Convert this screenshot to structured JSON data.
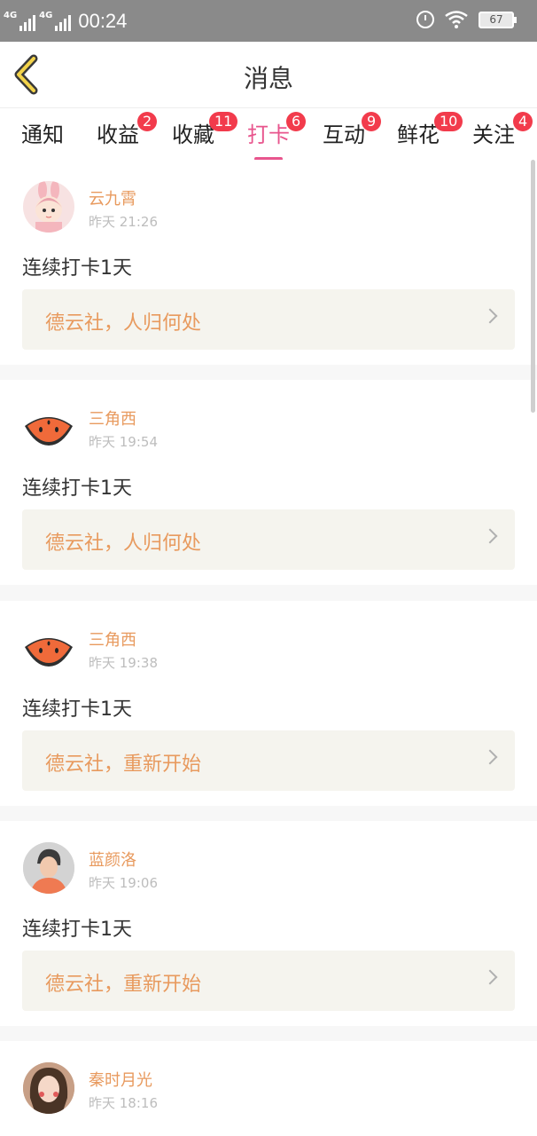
{
  "status_bar": {
    "signal1": "4G",
    "signal2": "4G",
    "time": "00:24",
    "battery": "67"
  },
  "header": {
    "title": "消息"
  },
  "tabs": [
    {
      "label": "通知",
      "badge": ""
    },
    {
      "label": "收益",
      "badge": "2"
    },
    {
      "label": "收藏",
      "badge": "11"
    },
    {
      "label": "打卡",
      "badge": "6"
    },
    {
      "label": "互动",
      "badge": "9"
    },
    {
      "label": "鲜花",
      "badge": "10"
    },
    {
      "label": "关注",
      "badge": "4"
    }
  ],
  "messages": [
    {
      "user": "云九霄",
      "time": "昨天 21:26",
      "text": "连续打卡1天",
      "link": "德云社，人归何处",
      "avatar": "cartoon-girl-avatar"
    },
    {
      "user": "三角西",
      "time": "昨天 19:54",
      "text": "连续打卡1天",
      "link": "德云社，人归何处",
      "avatar": "watermelon-avatar"
    },
    {
      "user": "三角西",
      "time": "昨天 19:38",
      "text": "连续打卡1天",
      "link": "德云社，重新开始",
      "avatar": "watermelon-avatar"
    },
    {
      "user": "蓝颜洛",
      "time": "昨天 19:06",
      "text": "连续打卡1天",
      "link": "德云社，重新开始",
      "avatar": "man-photo-avatar"
    },
    {
      "user": "秦时月光",
      "time": "昨天 18:16",
      "text": "",
      "link": "",
      "avatar": "girl-photo-avatar"
    }
  ],
  "colors": {
    "accent": "#e8558d",
    "badge": "#f23b4c",
    "username": "#e89a5e"
  }
}
